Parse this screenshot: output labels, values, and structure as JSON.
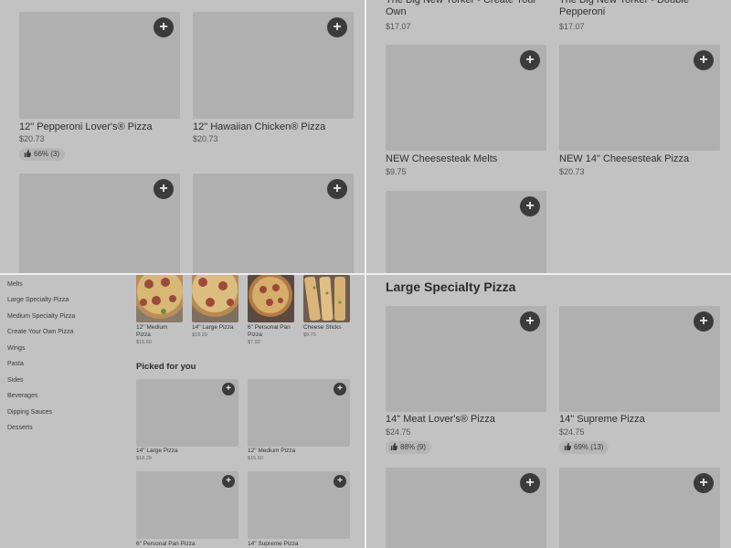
{
  "panel1": {
    "items": [
      {
        "name": "12\" Pepperoni Lover's® Pizza",
        "price": "$20.73",
        "rating": "66% (3)"
      },
      {
        "name": "12\" Hawaiian Chicken® Pizza",
        "price": "$20.73",
        "rating": ""
      },
      {
        "name": "",
        "price": "",
        "rating": ""
      },
      {
        "name": "",
        "price": "",
        "rating": ""
      }
    ]
  },
  "panel2": {
    "items": [
      {
        "name": "The Big New Yorker - Create Your Own",
        "price": "$17.07"
      },
      {
        "name": "The Big New Yorker - Double Pepperoni",
        "price": "$17.07"
      },
      {
        "name": "NEW Cheesesteak Melts",
        "price": "$9.75"
      },
      {
        "name": "NEW 14\" Cheesesteak Pizza",
        "price": "$20.73"
      }
    ]
  },
  "panel3": {
    "sidebar": [
      "Melts",
      "Large Specialty Pizza",
      "Medium Specialty Pizza",
      "Create Your Own Pizza",
      "Wings",
      "Pasta",
      "Sides",
      "Beverages",
      "Dipping Sauces",
      "Desserts"
    ],
    "popular": [
      {
        "name": "12\" Medium Pizza",
        "price": "$15.60"
      },
      {
        "name": "14\" Large Pizza",
        "price": "$18.29"
      },
      {
        "name": "6\" Personal Pan Pizza",
        "price": "$7.92"
      },
      {
        "name": "Cheese Sticks",
        "price": "$9.75"
      }
    ],
    "picked_title": "Picked for you",
    "picked": [
      {
        "name": "14\" Large Pizza",
        "price": "$18.29"
      },
      {
        "name": "12\" Medium Pizza",
        "price": "$15.60"
      },
      {
        "name": "6\" Personal Pan Pizza",
        "price": ""
      },
      {
        "name": "14\" Supreme Pizza",
        "price": ""
      }
    ]
  },
  "panel4": {
    "section_title": "Large Specialty Pizza",
    "items": [
      {
        "name": "14\" Meat Lover's® Pizza",
        "price": "$24.75",
        "rating": "88% (9)"
      },
      {
        "name": "14\" Supreme Pizza",
        "price": "$24.75",
        "rating": "69% (13)"
      }
    ]
  },
  "icons": {
    "add": "plus-icon",
    "rating": "thumbs-up-icon"
  },
  "add_symbol": "+"
}
